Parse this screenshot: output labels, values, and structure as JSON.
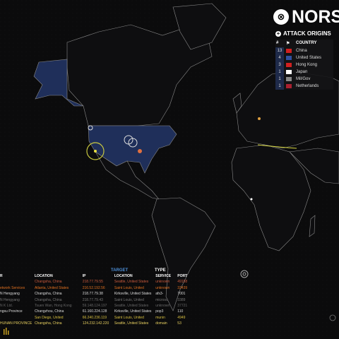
{
  "brand": {
    "logo_text": "NORSE",
    "logo_mark": "⊗"
  },
  "origins": {
    "title": "ATTACK ORIGINS",
    "headers": {
      "count": "#",
      "country": "COUNTRY"
    },
    "rows": [
      {
        "count": "13",
        "country": "China",
        "flag": "#d02020"
      },
      {
        "count": "4",
        "country": "United States",
        "flag": "#3050a0"
      },
      {
        "count": "3",
        "country": "Hong Kong",
        "flag": "#d02020"
      },
      {
        "count": "1",
        "country": "Japan",
        "flag": "#ffffff"
      },
      {
        "count": "1",
        "country": "Mil/Gov",
        "flag": "#888888"
      },
      {
        "count": "1",
        "country": "Netherlands",
        "flag": "#aa2030"
      }
    ]
  },
  "attacks": {
    "target_label": "TARGET",
    "type_label": "TYPE",
    "headers": {
      "org": "R",
      "location": "LOCATION",
      "ip": "IP",
      "target_location": "LOCATION",
      "service": "SERVICE",
      "port": "PORT"
    },
    "rows": [
      {
        "org": "",
        "location": "Changsha, China",
        "ip": "218.77.79.55",
        "target_location": "Seattle, United States",
        "service": "unknown",
        "port": "49158",
        "color": "#c95a3d"
      },
      {
        "org": "etwork Services",
        "location": "Atlanta, United States",
        "ip": "216.52.192.56",
        "target_location": "Saint Louis, United",
        "service": "unknown",
        "port": "33439",
        "color": "#e07020"
      },
      {
        "org": "N Hengyang",
        "location": "Changsha, China",
        "ip": "218.77.79.38",
        "target_location": "Kirksville, United States",
        "service": "afs3-",
        "port": "7001",
        "color": "#ddd"
      },
      {
        "org": "N Hengyang",
        "location": "Changsha, China",
        "ip": "218.77.79.43",
        "target_location": "Saint Louis, United",
        "service": "microso",
        "port": "3389",
        "color": "#777"
      },
      {
        "org": "N K Ltd.",
        "location": "Tsuen Wan, Hong Kong",
        "ip": "59.148.124.197",
        "target_location": "Seattle, United States",
        "service": "unknown",
        "port": "37721",
        "color": "#666"
      },
      {
        "org": "ngsu Province",
        "location": "Changzhou, China",
        "ip": "61.160.224.128",
        "target_location": "Kirksville, United States",
        "service": "pop3",
        "port": "110",
        "color": "#ddd"
      },
      {
        "org": "",
        "location": "San Diego, United",
        "ip": "66.240.236.119",
        "target_location": "Saint Louis, United",
        "service": "munin",
        "port": "4949",
        "color": "#d8c040"
      },
      {
        "org": "HUNAN PROVINCE",
        "location": "Changsha, China",
        "ip": "124.232.142.220",
        "target_location": "Seattle, United States",
        "service": "domain",
        "port": "53",
        "color": "#e8d060"
      }
    ]
  },
  "icons": {
    "scan": "target-scan-icon",
    "corner": "corner-globe-icon",
    "bars": "volume-bars-icon"
  },
  "colors": {
    "accent_blue": "#4d8fd8",
    "highlight_land": "#1f2f5a",
    "attack_yellow": "#e8e040",
    "attack_orange": "#e07040"
  }
}
